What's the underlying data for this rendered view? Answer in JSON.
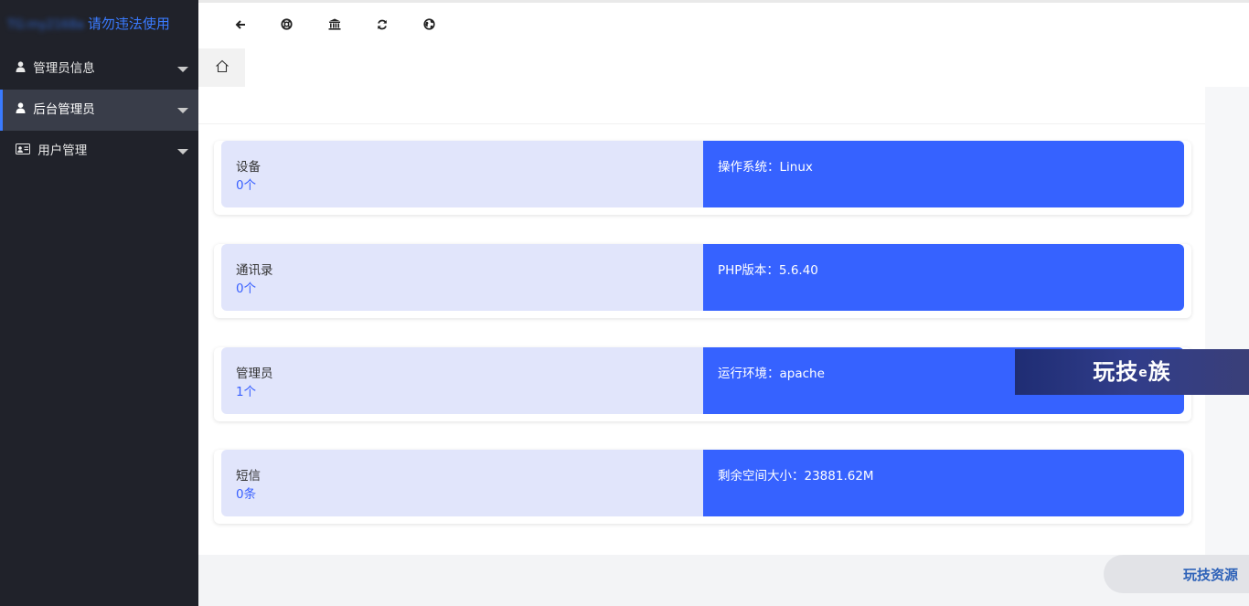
{
  "sidebar": {
    "logo_blur": "TG:my2168a",
    "logo_warning": "请勿违法使用",
    "items": [
      {
        "label": "管理员信息",
        "icon": "user-icon",
        "active": false
      },
      {
        "label": "后台管理员",
        "icon": "user-icon",
        "active": true
      },
      {
        "label": "用户管理",
        "icon": "id-card-icon",
        "active": false
      }
    ]
  },
  "toolbar": {
    "buttons": [
      "back-icon",
      "help-icon",
      "bank-icon",
      "refresh-icon",
      "globe-icon"
    ]
  },
  "tabs": {
    "home_icon": "home-icon"
  },
  "stats": [
    {
      "label": "设备",
      "value": "0个",
      "info": "操作系统：Linux"
    },
    {
      "label": "通讯录",
      "value": "0个",
      "info": "PHP版本：5.6.40"
    },
    {
      "label": "管理员",
      "value": "1个",
      "info": "运行环境：apache"
    },
    {
      "label": "短信",
      "value": "0条",
      "info": "剩余空间大小：23881.62M"
    }
  ],
  "watermarks": {
    "banner_main": "玩技",
    "banner_e": "e",
    "banner_end": "族",
    "corner": "玩技资源"
  },
  "colors": {
    "sidebar_bg": "#20222a",
    "accent": "#3662ff",
    "card_left_bg": "#e1e5fb"
  }
}
